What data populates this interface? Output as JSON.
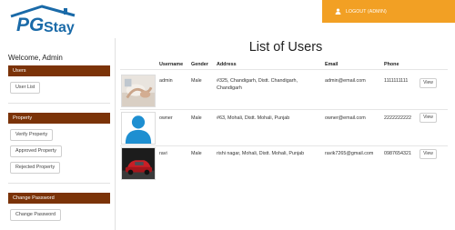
{
  "header": {
    "logo_text": "PGStay",
    "logout_label": "LOGOUT (ADMIN)",
    "brand_color": "#1a6aa8",
    "accent_color": "#f2a024"
  },
  "sidebar": {
    "welcome": "Welcome, Admin",
    "sections": [
      {
        "title": "Users",
        "buttons": [
          "User List"
        ]
      },
      {
        "title": "Property",
        "buttons": [
          "Verify Property",
          "Approved Property",
          "Rejected Property"
        ]
      },
      {
        "title": "Change Password",
        "buttons": [
          "Change Password"
        ]
      }
    ],
    "section_color": "#7b3308"
  },
  "main": {
    "title": "List of Users",
    "columns": [
      "",
      "Username",
      "Gender",
      "Address",
      "Email",
      "Phone",
      ""
    ],
    "users": [
      {
        "avatar": "hands-photo",
        "username": "admin",
        "gender": "Male",
        "address_line1": "#325, Chandigarh, Distt. Chandigarh,",
        "address_line2": "Chandigarh",
        "email": "admin@email.com",
        "phone": "1111111111",
        "action": "View"
      },
      {
        "avatar": "default-person-icon",
        "username": "owner",
        "gender": "Male",
        "address_line1": "#63, Mohali, Distt. Mohali, Punjab",
        "address_line2": "",
        "email": "owner@email.com",
        "phone": "2222222222",
        "action": "View"
      },
      {
        "avatar": "red-car-photo",
        "username": "ravi",
        "gender": "Male",
        "address_line1": "rishi nagar, Mohali, Distt. Mohali, Punjab",
        "address_line2": "",
        "email": "ravik7265@gmail.com",
        "phone": "0987654321",
        "action": "View"
      }
    ]
  }
}
